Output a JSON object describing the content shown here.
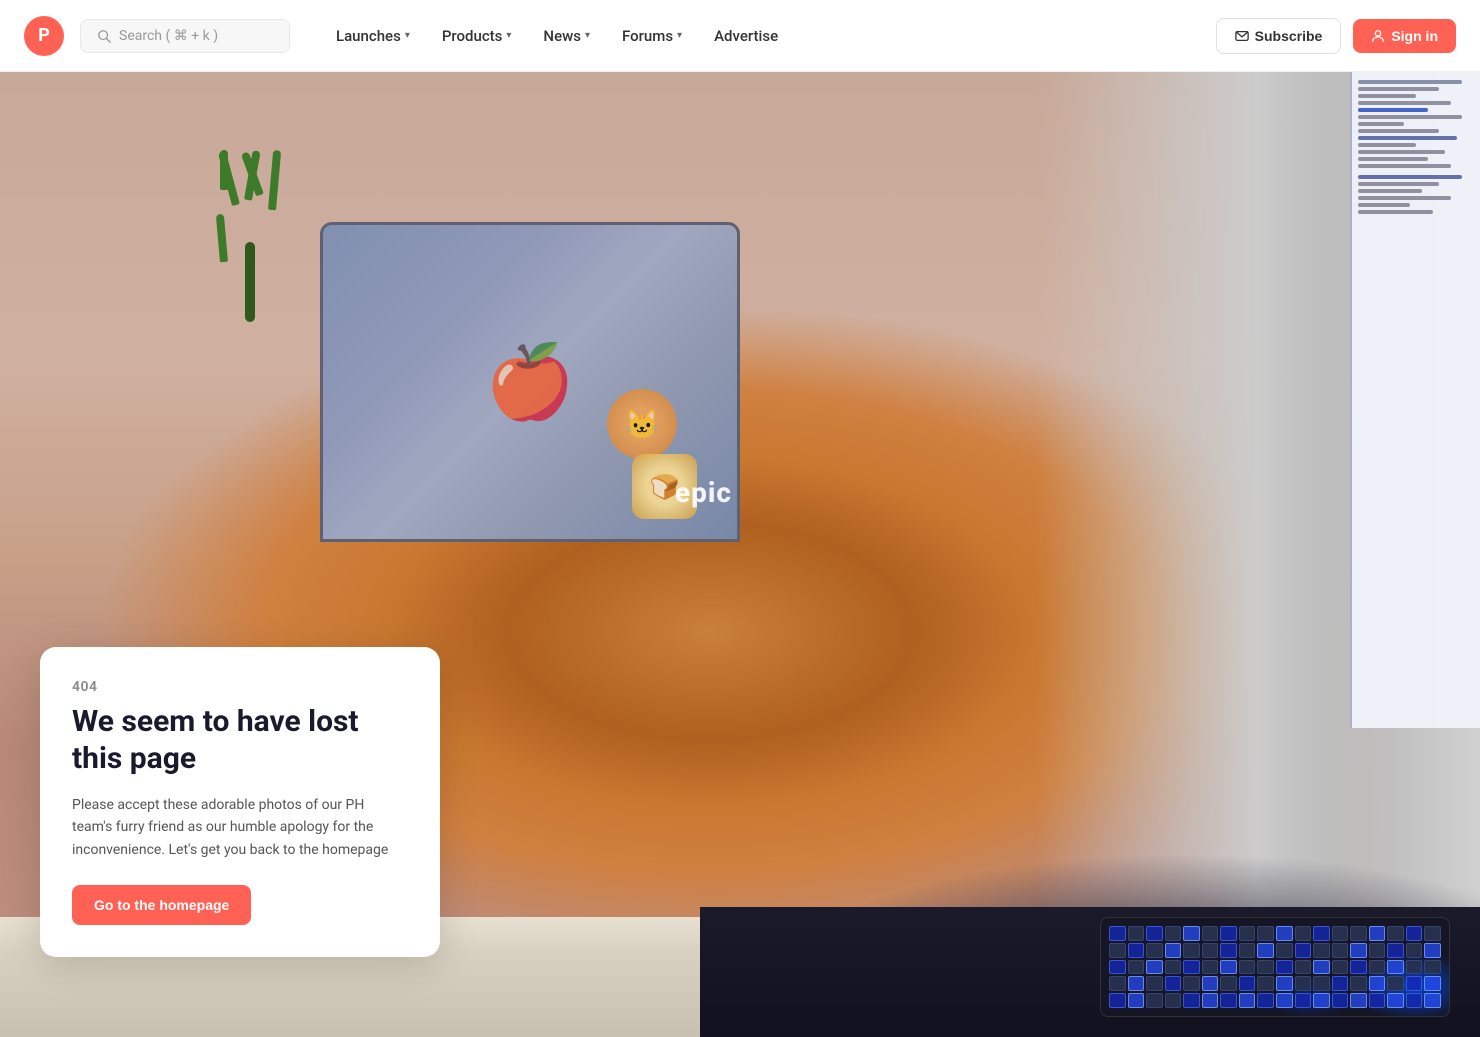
{
  "brand": {
    "logo_letter": "P",
    "logo_color": "#ff6154"
  },
  "navbar": {
    "search_placeholder": "Search ( ⌘ + k )",
    "items": [
      {
        "label": "Launches",
        "has_chevron": true
      },
      {
        "label": "Products",
        "has_chevron": true
      },
      {
        "label": "News",
        "has_chevron": true
      },
      {
        "label": "Forums",
        "has_chevron": true
      },
      {
        "label": "Advertise",
        "has_chevron": false
      }
    ],
    "subscribe_label": "Subscribe",
    "signin_label": "Sign in"
  },
  "error_page": {
    "code": "404",
    "title": "We seem to have lost this page",
    "body": "Please accept these adorable photos of our PH team's furry friend as our humble apology for the inconvenience. Let's get you back to the homepage",
    "cta_label": "Go to the homepage"
  }
}
